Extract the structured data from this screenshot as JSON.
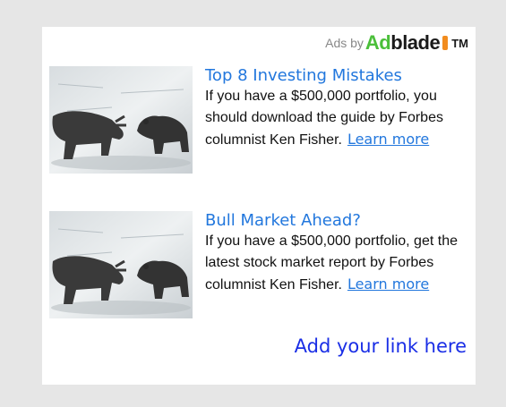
{
  "attribution": {
    "prefix": "Ads by",
    "brand_part1": "Ad",
    "brand_part2": "blade",
    "trademark": "TM"
  },
  "ads": [
    {
      "title": "Top 8 Investing Mistakes",
      "body": "If you have a $500,000 portfolio, you should download the guide by Forbes columnist Ken Fisher.",
      "cta": "Learn more",
      "image_icon": "bull-and-bear-figurines"
    },
    {
      "title": "Bull Market Ahead?",
      "body": "If you have a $500,000 portfolio, get the latest stock market report by Forbes columnist Ken Fisher.",
      "cta": "Learn more",
      "image_icon": "bull-and-bear-figurines"
    }
  ],
  "footer": {
    "add_link": "Add your link here"
  },
  "colors": {
    "link": "#2277dd",
    "add_link": "#1a2ee6",
    "brand_green": "#4bbf3a",
    "brand_orange": "#f28c1e",
    "background": "#e6e6e6"
  }
}
